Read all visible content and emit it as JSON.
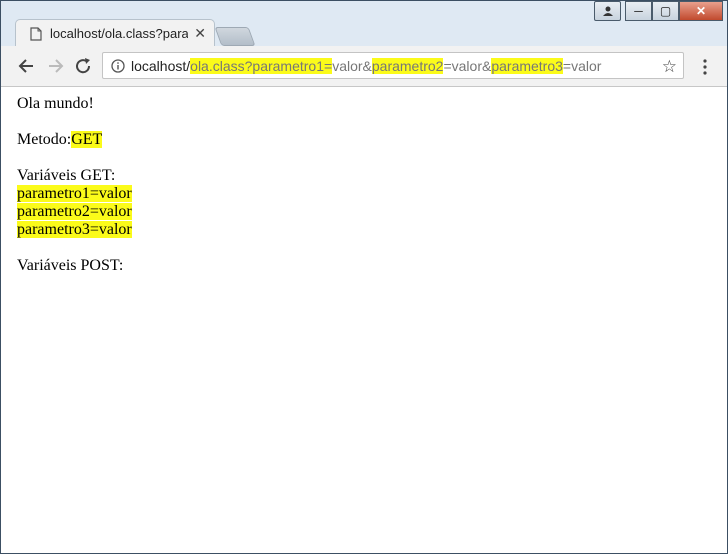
{
  "window": {
    "tab_title": "localhost/ola.class?param",
    "controls": {
      "minimize": "─",
      "maximize": "▢",
      "close": "✕"
    }
  },
  "toolbar": {
    "url_host": "localhost/",
    "url_parts": [
      {
        "text": "ola.class?parametro1=",
        "highlight": true
      },
      {
        "text": "valor&",
        "highlight": false
      },
      {
        "text": "parametro2",
        "highlight": true
      },
      {
        "text": "=valor&",
        "highlight": false
      },
      {
        "text": "parametro3",
        "highlight": true
      },
      {
        "text": "=valor",
        "highlight": false
      }
    ]
  },
  "page": {
    "greeting": "Ola mundo!",
    "method_label": "Metodo:",
    "method_value": "GET",
    "get_heading": "Variáveis GET:",
    "get_vars": [
      "parametro1=valor",
      "parametro2=valor",
      "parametro3=valor"
    ],
    "post_heading": "Variáveis POST:"
  },
  "colors": {
    "highlight": "#fbfb1a",
    "frame": "#dfe9f3"
  }
}
